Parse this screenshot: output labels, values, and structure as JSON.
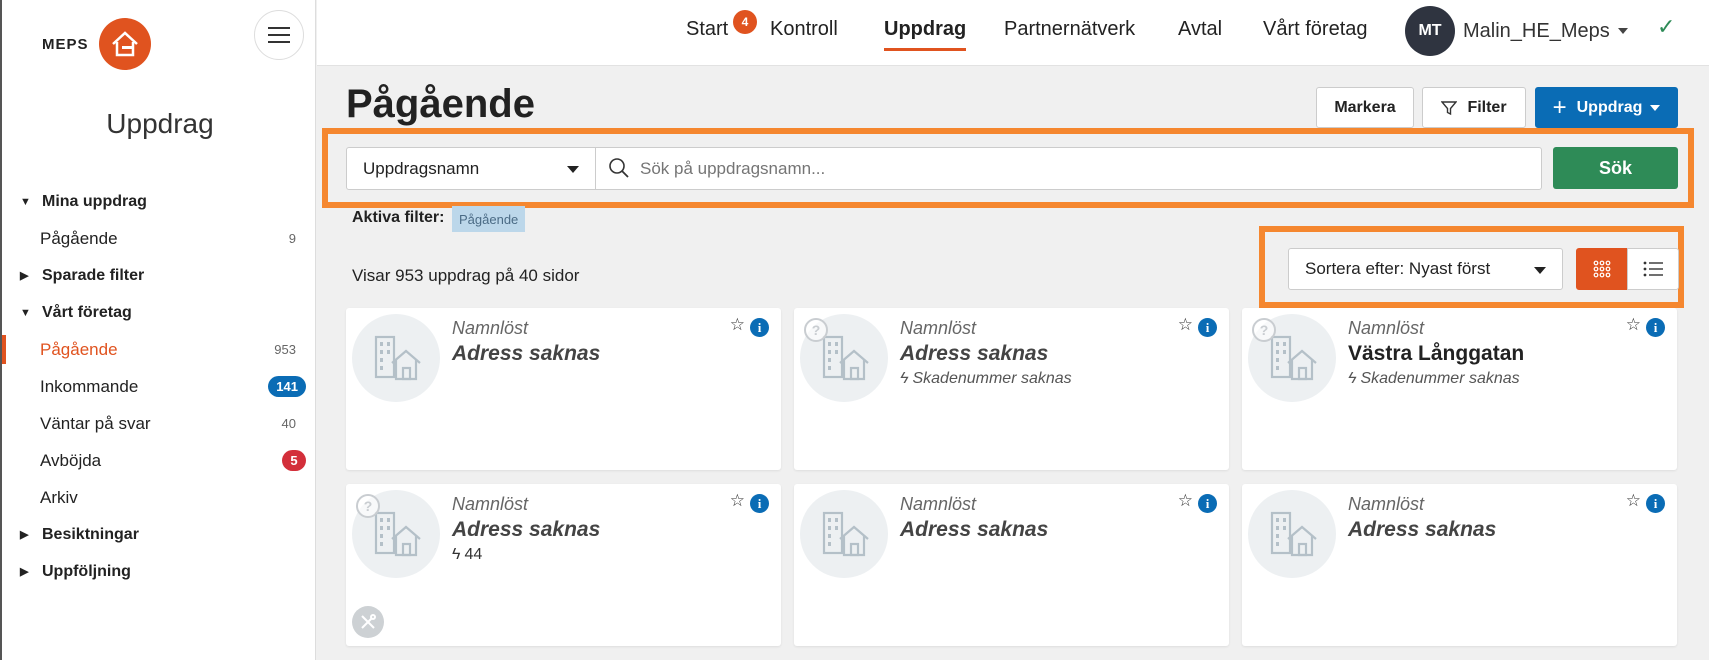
{
  "brand": {
    "name": "MEPS"
  },
  "sidebar": {
    "title": "Uppdrag",
    "groups": [
      {
        "label": "Mina uppdrag"
      },
      {
        "label": "Sparade filter"
      },
      {
        "label": "Vårt företag"
      },
      {
        "label": "Besiktningar"
      },
      {
        "label": "Uppföljning"
      }
    ],
    "items": [
      {
        "label": "Pågående",
        "count": "9"
      },
      {
        "label": "Pågående",
        "count": "953"
      },
      {
        "label": "Inkommande",
        "count": "141"
      },
      {
        "label": "Väntar på svar",
        "count": "40"
      },
      {
        "label": "Avböjda",
        "count": "5"
      },
      {
        "label": "Arkiv",
        "count": ""
      }
    ]
  },
  "topnav": {
    "items": [
      "Start",
      "Kontroll",
      "Uppdrag",
      "Partnernätverk",
      "Avtal",
      "Vårt företag"
    ],
    "start_badge": "4",
    "user_initials": "MT",
    "user_name": "Malin_HE_Meps"
  },
  "main": {
    "title": "Pågående",
    "btn_mark": "Markera",
    "btn_filter": "Filter",
    "btn_new": "Uppdrag",
    "search_field": "Uppdragsnamn",
    "search_placeholder": "Sök på uppdragsnamn...",
    "search_button": "Sök",
    "active_filter_label": "Aktiva filter:",
    "active_filter_chip": "Pågående",
    "showing": "Visar 953 uppdrag på 40 sidor",
    "sort_label": "Sortera efter: Nyast först"
  },
  "cards": [
    {
      "name": "Namnlöst",
      "address": "Adress saknas",
      "claim": ""
    },
    {
      "name": "Namnlöst",
      "address": "Adress saknas",
      "claim": "Skadenummer saknas"
    },
    {
      "name": "Namnlöst",
      "address": "Västra Långgatan",
      "claim": "Skadenummer saknas"
    },
    {
      "name": "Namnlöst",
      "address": "Adress saknas",
      "claim": "44"
    },
    {
      "name": "Namnlöst",
      "address": "Adress saknas",
      "claim": ""
    },
    {
      "name": "Namnlöst",
      "address": "Adress saknas",
      "claim": ""
    }
  ],
  "colors": {
    "accent": "#e0531f",
    "primary": "#0a6cb5",
    "success": "#2e8b57",
    "highlight": "#f5872f"
  }
}
